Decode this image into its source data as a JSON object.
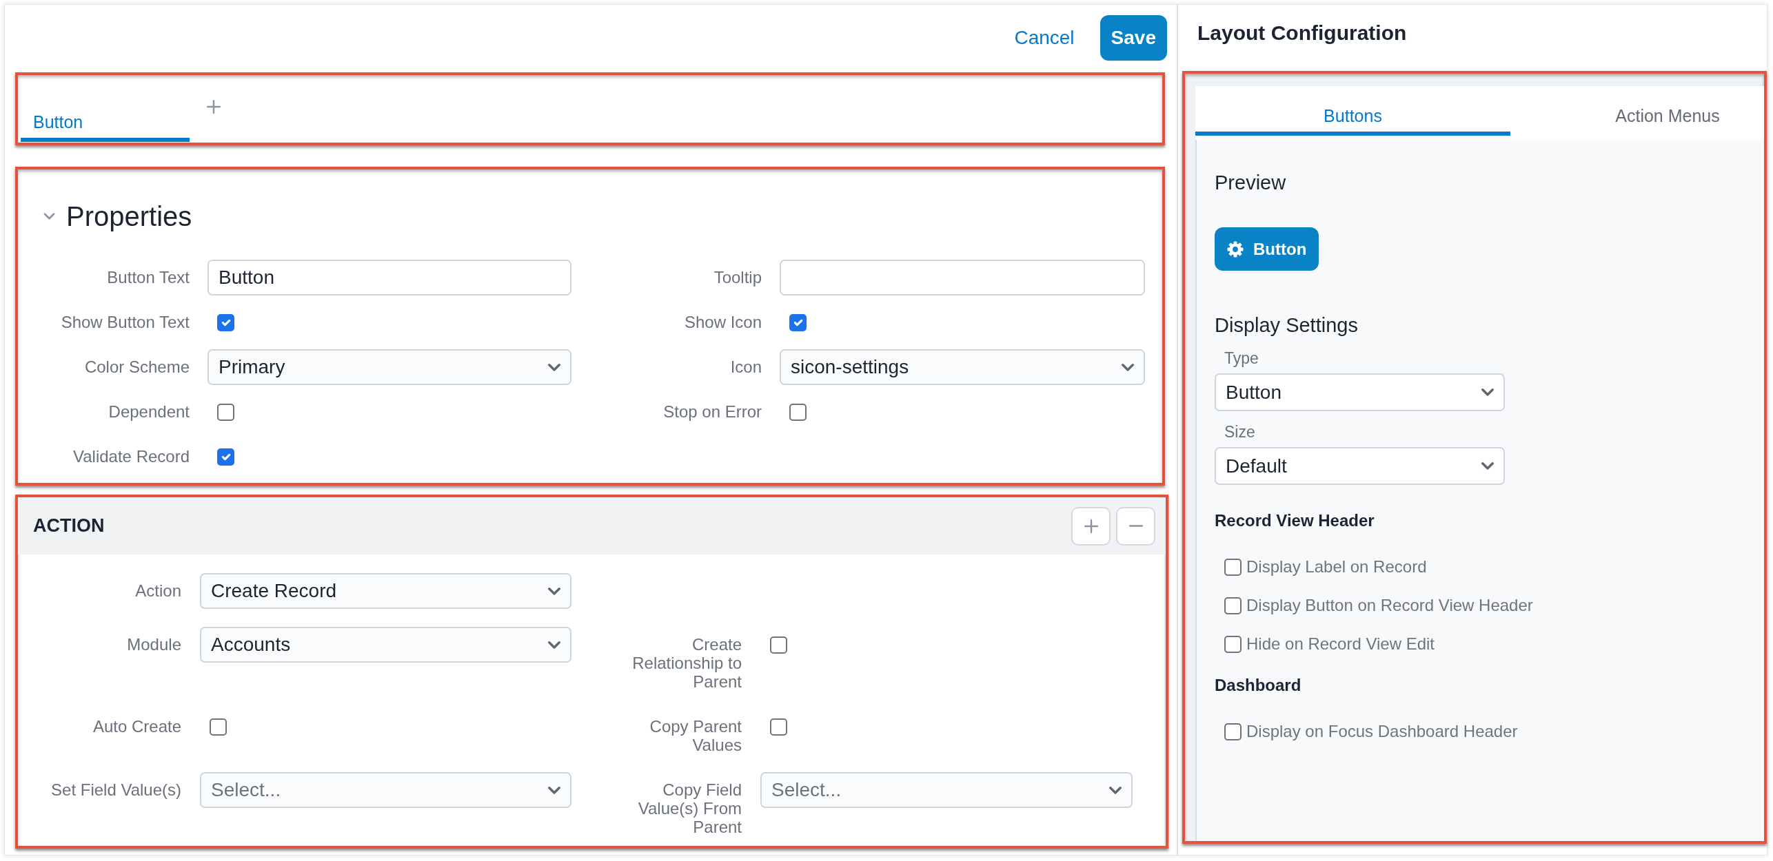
{
  "header": {
    "cancel": "Cancel",
    "save": "Save"
  },
  "tab_bar": {
    "highlighted": true,
    "tabs": [
      {
        "label": "Button",
        "selected": true
      }
    ]
  },
  "properties": {
    "highlighted": true,
    "title": "Properties",
    "expanded": true,
    "rows": [
      [
        {
          "label": "Button Text",
          "kind": "text",
          "value": "Button"
        },
        {
          "label": "Tooltip",
          "kind": "text"
        }
      ],
      [
        {
          "label": "Show Button Text",
          "kind": "checkbox",
          "checked": true
        },
        {
          "label": "Show Icon",
          "kind": "checkbox",
          "checked": true
        }
      ],
      [
        {
          "label": "Color Scheme",
          "kind": "select",
          "value": "Primary"
        },
        {
          "label": "Icon",
          "kind": "select",
          "value": "sicon-settings"
        }
      ],
      [
        {
          "label": "Dependent",
          "kind": "checkbox",
          "checked": false
        },
        {
          "label": "Stop on Error",
          "kind": "checkbox",
          "checked": false
        }
      ],
      [
        {
          "label": "Validate Record",
          "kind": "checkbox",
          "checked": true
        }
      ]
    ]
  },
  "action": {
    "highlighted": true,
    "title": "ACTION",
    "rows": [
      [
        {
          "label": "Action",
          "kind": "select",
          "value": "Create Record"
        }
      ],
      [
        {
          "label": "Module",
          "kind": "select",
          "value": "Accounts"
        },
        {
          "label": "Create Relationship to Parent",
          "kind": "checkbox",
          "checked": false
        }
      ],
      [
        {
          "label": "Auto Create",
          "kind": "checkbox",
          "checked": false
        },
        {
          "label": "Copy Parent Values",
          "kind": "checkbox",
          "checked": false
        }
      ],
      [
        {
          "label": "Set Field Value(s)",
          "kind": "select",
          "placeholder": "Select..."
        },
        {
          "label": "Copy Field Value(s) From Parent",
          "kind": "select",
          "placeholder": "Select..."
        }
      ]
    ]
  },
  "layout_configuration": {
    "title": "Layout Configuration",
    "highlighted": true,
    "tabs": [
      {
        "label": "Buttons",
        "selected": true
      },
      {
        "label": "Action Menus",
        "selected": false
      }
    ],
    "preview": {
      "heading": "Preview",
      "button_label": "Button"
    },
    "display_settings": {
      "heading": "Display Settings",
      "fields": [
        {
          "label": "Type",
          "value": "Button"
        },
        {
          "label": "Size",
          "value": "Default"
        }
      ]
    },
    "groups": [
      {
        "heading": "Record View Header",
        "options": [
          {
            "label": "Display Label on Record",
            "checked": false
          },
          {
            "label": "Display Button on Record View Header",
            "checked": false
          },
          {
            "label": "Hide on Record View Edit",
            "checked": false
          }
        ]
      },
      {
        "heading": "Dashboard",
        "options": [
          {
            "label": "Display on Focus Dashboard Header",
            "checked": false
          }
        ]
      }
    ]
  }
}
